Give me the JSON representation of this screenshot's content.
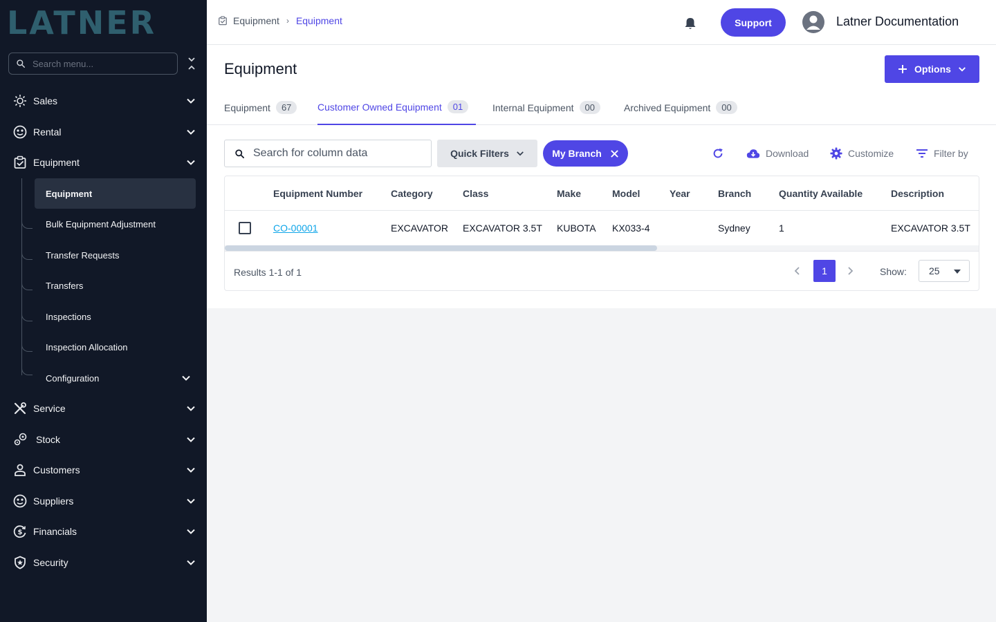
{
  "brand": {
    "logo_text": "LATNER"
  },
  "sidebar": {
    "search_placeholder": "Search menu...",
    "items": [
      {
        "label": "Sales",
        "icon": "sales-icon"
      },
      {
        "label": "Rental",
        "icon": "rental-icon"
      },
      {
        "label": "Equipment",
        "icon": "equipment-icon"
      },
      {
        "label": "Service",
        "icon": "service-icon"
      },
      {
        "label": "Stock",
        "icon": "stock-icon"
      },
      {
        "label": "Customers",
        "icon": "customers-icon"
      },
      {
        "label": "Suppliers",
        "icon": "suppliers-icon"
      },
      {
        "label": "Financials",
        "icon": "financials-icon"
      },
      {
        "label": "Security",
        "icon": "security-icon"
      }
    ],
    "equipment_sub": [
      {
        "label": "Equipment",
        "active": true
      },
      {
        "label": "Bulk Equipment Adjustment"
      },
      {
        "label": "Transfer Requests"
      },
      {
        "label": "Transfers"
      },
      {
        "label": "Inspections"
      },
      {
        "label": "Inspection Allocation"
      },
      {
        "label": "Configuration"
      }
    ]
  },
  "topbar": {
    "breadcrumb": [
      "Equipment",
      "Equipment"
    ],
    "support_label": "Support",
    "user_name": "Latner Documentation"
  },
  "page": {
    "title": "Equipment",
    "options_label": "Options",
    "tabs": [
      {
        "label": "Equipment",
        "count": "67"
      },
      {
        "label": "Customer Owned Equipment",
        "count": "01",
        "active": true
      },
      {
        "label": "Internal Equipment",
        "count": "00"
      },
      {
        "label": "Archived Equipment",
        "count": "00"
      }
    ]
  },
  "toolbar": {
    "search_placeholder": "Search for column data",
    "quick_filters_label": "Quick Filters",
    "chip_label": "My Branch",
    "download_label": "Download",
    "customize_label": "Customize",
    "filter_label": "Filter by"
  },
  "table": {
    "columns": [
      "Equipment Number",
      "Category",
      "Class",
      "Make",
      "Model",
      "Year",
      "Branch",
      "Quantity Available",
      "Description"
    ],
    "rows": [
      [
        "CO-00001",
        "EXCAVATOR",
        "EXCAVATOR 3.5T",
        "KUBOTA",
        "KX033-4",
        "",
        "Sydney",
        "1",
        "EXCAVATOR 3.5T"
      ]
    ]
  },
  "pagination": {
    "results_text": "Results 1-1 of 1",
    "current_page": "1",
    "show_label": "Show:",
    "page_size": "25"
  },
  "colors": {
    "accent": "#4f46e5",
    "sidebar_bg": "#111827",
    "link": "#0ea5e9"
  }
}
